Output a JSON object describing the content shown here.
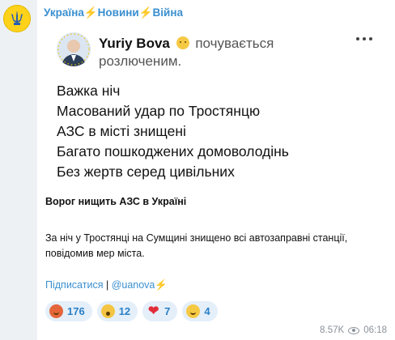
{
  "channel": {
    "name_parts": [
      "Україна",
      "Новини",
      "Війна"
    ],
    "bolt": "⚡",
    "avatar_icon": "trident-icon",
    "avatar_color": "#ffd21a"
  },
  "post": {
    "author": "Yuriy Bova",
    "feeling": "почувається",
    "feeling_line2": "розлюченим.",
    "lines": [
      "Важка ніч",
      "Масований удар по Тростянцю",
      "АЗС в місті знищені",
      "Багато пошкоджених домоволодінь",
      "Без жертв серед цивільних"
    ]
  },
  "headline": "Ворог нищить АЗС в Україні",
  "body": "За ніч у Тростянці на Сумщині знищено всі автозаправні станції, повідомив мер міста.",
  "links": {
    "subscribe": "Підписатися",
    "separator": "|",
    "handle": "@uanova",
    "bolt": "⚡"
  },
  "reactions": [
    {
      "emoji": "angry-face-icon",
      "count": "176"
    },
    {
      "emoji": "screaming-face-icon",
      "count": "12"
    },
    {
      "emoji": "red-heart-icon",
      "count": "7"
    },
    {
      "emoji": "grinning-face-icon",
      "count": "4"
    }
  ],
  "meta": {
    "views": "8.57K",
    "time": "06:18"
  },
  "colors": {
    "link": "#3a8fd0",
    "accent": "#f2b705",
    "reaction_bg": "#e4effa"
  }
}
